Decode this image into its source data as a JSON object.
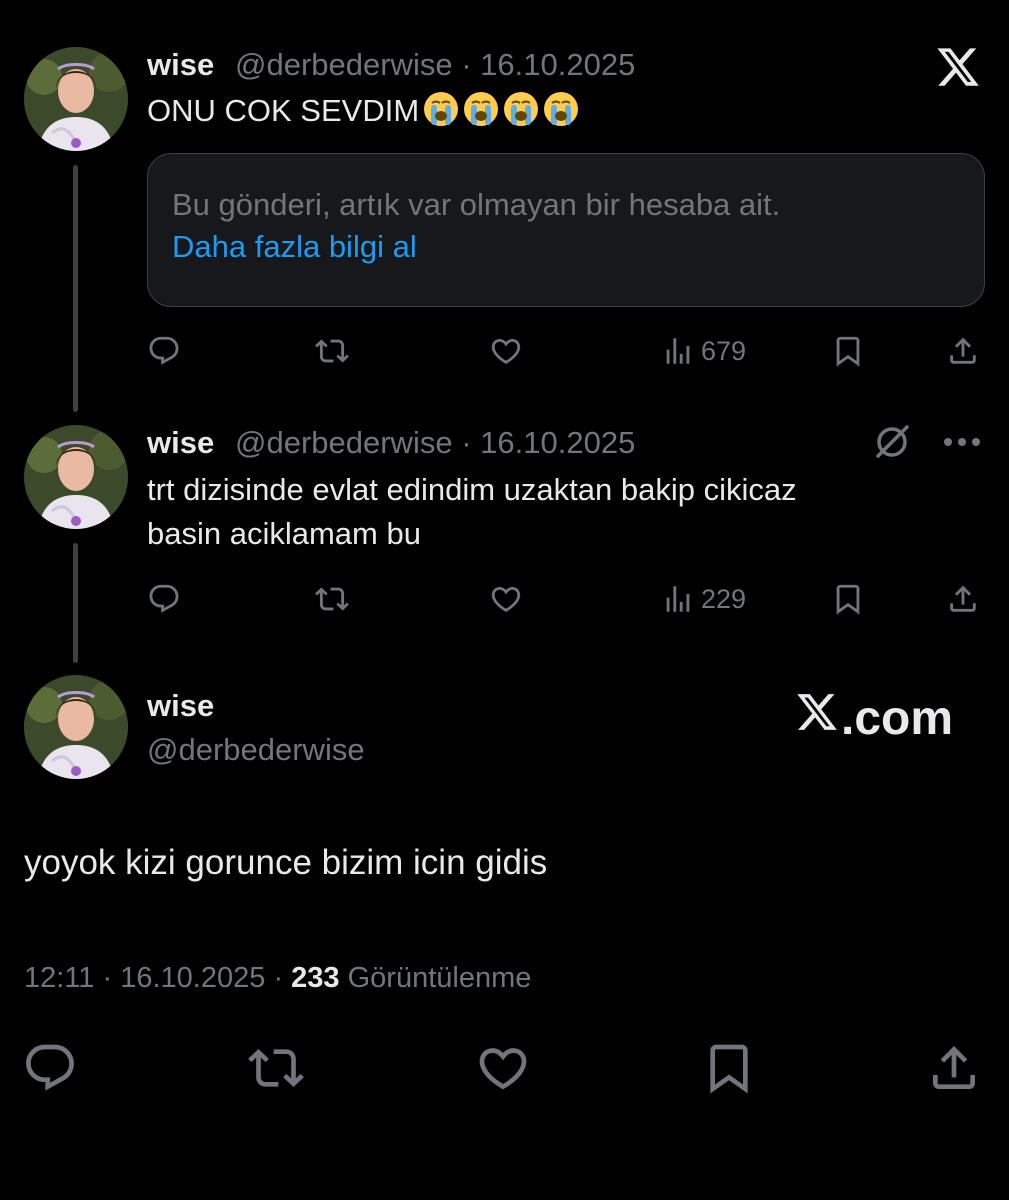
{
  "tweets": [
    {
      "name": "wise",
      "handle": "@derbederwise",
      "date": "16.10.2025",
      "separator": "·",
      "text": "ONU COK SEVDIM",
      "emojis": [
        "loudly-crying-face",
        "loudly-crying-face",
        "loudly-crying-face",
        "loudly-crying-face"
      ],
      "notice": {
        "text": "Bu gönderi, artık var olmayan bir hesaba ait.",
        "link": "Daha fazla bilgi al"
      },
      "views": "679"
    },
    {
      "name": "wise",
      "handle": "@derbederwise",
      "date": "16.10.2025",
      "separator": "·",
      "text_line1": "trt dizisinde evlat edindim uzaktan bakip cikicaz",
      "text_line2": "basin aciklamam bu",
      "views": "229"
    }
  ],
  "main": {
    "name": "wise",
    "handle": "@derbederwise",
    "brand": ".com",
    "text": "yoyok kizi gorunce bizim icin gidis",
    "time": "12:11",
    "date": "16.10.2025",
    "separator": "·",
    "views_count": "233",
    "views_label": "Görüntülenme"
  },
  "colors": {
    "background": "#000000",
    "text": "#e7e9ea",
    "muted": "#71767b",
    "link": "#1d9bf0",
    "border": "#3e4144"
  },
  "icons": [
    "x-logo",
    "grok-icon",
    "more-icon",
    "reply-icon",
    "repost-icon",
    "like-icon",
    "views-icon",
    "bookmark-icon",
    "share-icon"
  ]
}
